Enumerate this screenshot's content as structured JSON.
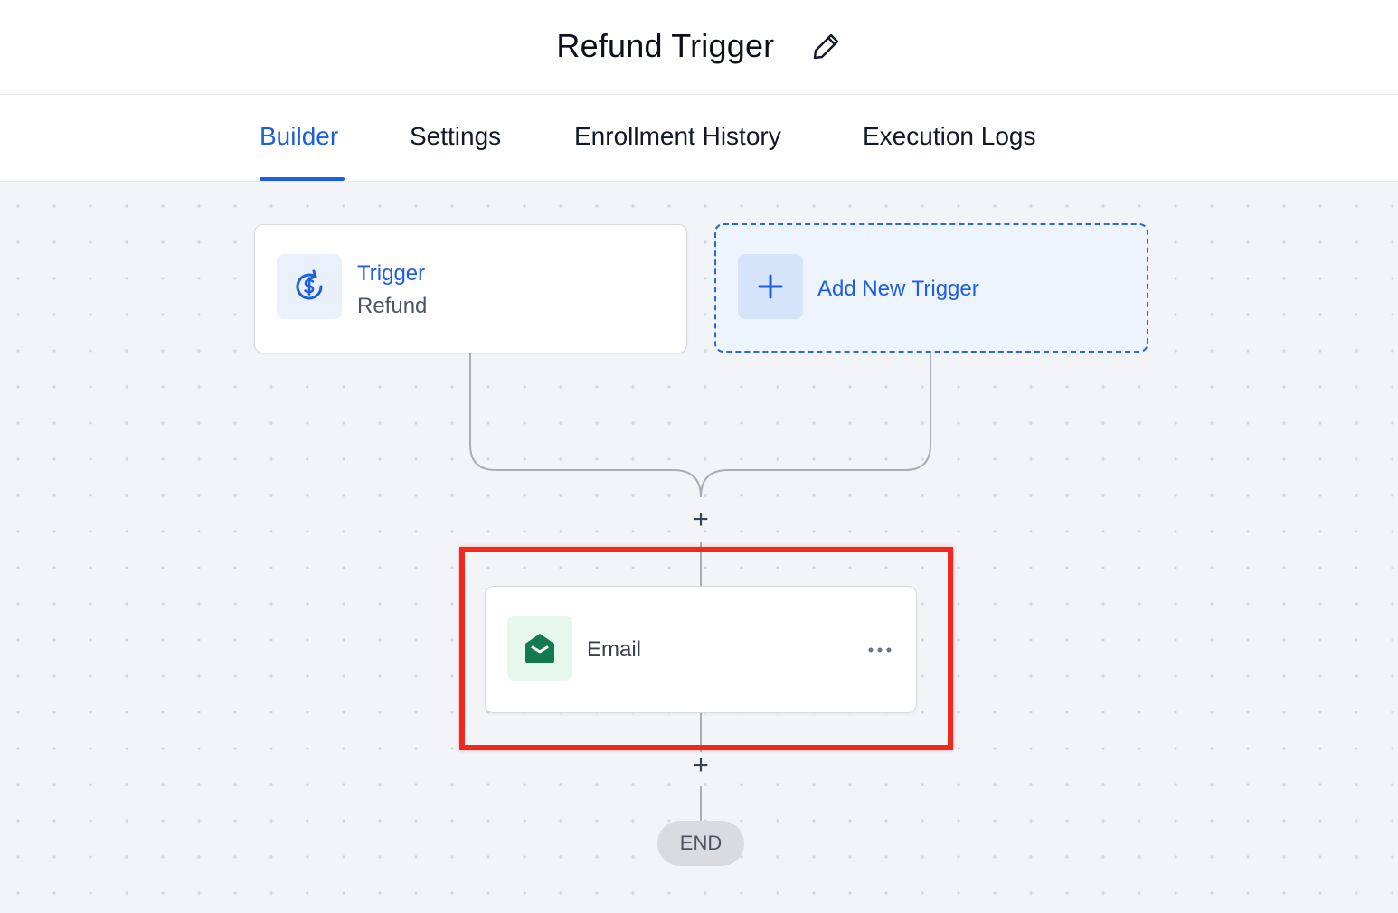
{
  "header": {
    "title": "Refund Trigger",
    "edit_icon": "pencil-icon"
  },
  "tabs": [
    {
      "label": "Builder",
      "active": true
    },
    {
      "label": "Settings",
      "active": false
    },
    {
      "label": "Enrollment History",
      "active": false
    },
    {
      "label": "Execution Logs",
      "active": false
    }
  ],
  "workflow": {
    "trigger": {
      "title": "Trigger",
      "subtitle": "Refund",
      "icon": "refund-dollar-icon"
    },
    "add_trigger": {
      "label": "Add New Trigger",
      "icon": "plus-icon"
    },
    "steps": [
      {
        "label": "Email",
        "icon": "envelope-icon",
        "menu_icon": "more-horizontal-icon"
      }
    ],
    "add_step_symbol": "+",
    "end_label": "END"
  },
  "colors": {
    "accent": "#1d5fe0",
    "highlight": "#f0281e",
    "email_icon": "#137a4f",
    "canvas_bg": "#f2f4f7"
  }
}
